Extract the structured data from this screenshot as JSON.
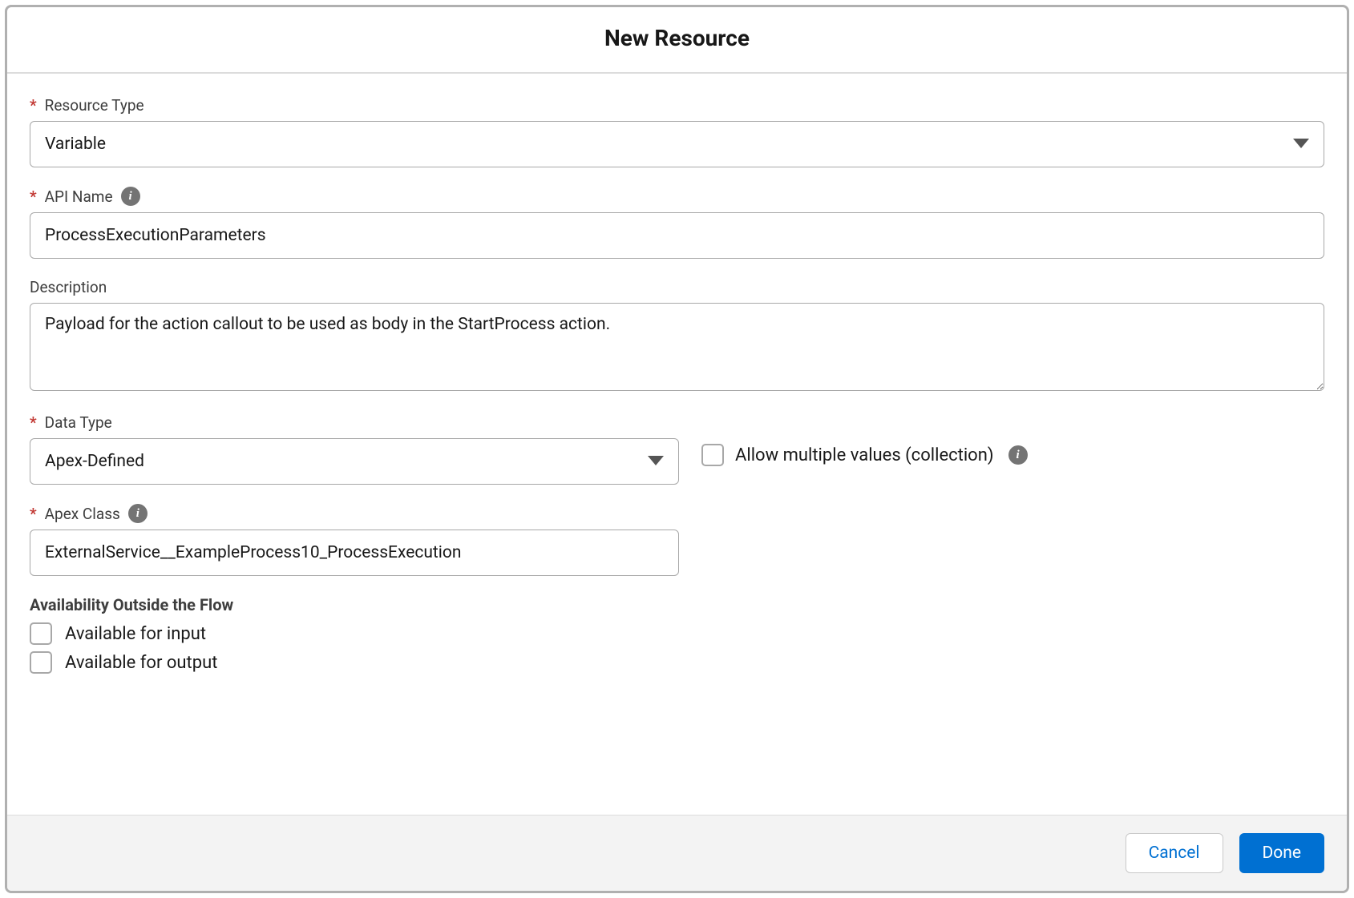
{
  "header": {
    "title": "New Resource"
  },
  "form": {
    "resourceType": {
      "label": "Resource Type",
      "value": "Variable"
    },
    "apiName": {
      "label": "API Name",
      "value": "ProcessExecutionParameters"
    },
    "description": {
      "label": "Description",
      "value": "Payload for the action callout to be used as body in the StartProcess action."
    },
    "dataType": {
      "label": "Data Type",
      "value": "Apex-Defined"
    },
    "allowMultiple": {
      "label": "Allow multiple values (collection)",
      "checked": false
    },
    "apexClass": {
      "label": "Apex Class",
      "value": "ExternalService__ExampleProcess10_ProcessExecution"
    },
    "availability": {
      "heading": "Availability Outside the Flow",
      "input": {
        "label": "Available for input",
        "checked": false
      },
      "output": {
        "label": "Available for output",
        "checked": false
      }
    }
  },
  "footer": {
    "cancel": "Cancel",
    "done": "Done"
  }
}
